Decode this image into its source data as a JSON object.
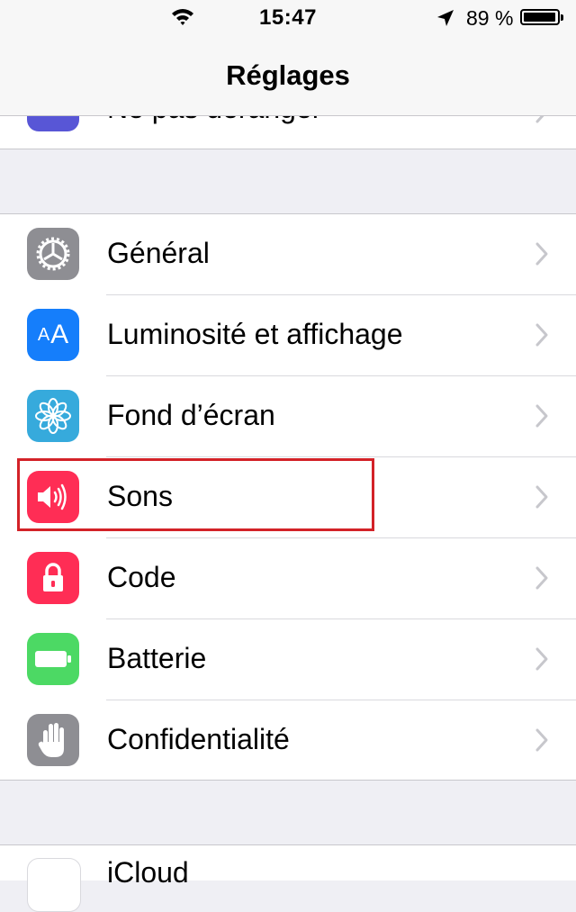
{
  "status_bar": {
    "time": "15:47",
    "battery_percent": "89 %",
    "battery_level": 0.89
  },
  "nav": {
    "title": "Réglages"
  },
  "partial_top_item": {
    "label": "Ne pas déranger",
    "icon_color": "#5856d6",
    "icon": "moon-icon"
  },
  "settings_items": [
    {
      "label": "Général",
      "icon": "gear-icon",
      "icon_color": "#8e8e93"
    },
    {
      "label": "Luminosité et affichage",
      "icon": "text-size-icon",
      "icon_color": "#157efb"
    },
    {
      "label": "Fond d’écran",
      "icon": "flower-icon",
      "icon_color": "#36aadc"
    },
    {
      "label": "Sons",
      "icon": "speaker-icon",
      "icon_color": "#ff2d55"
    },
    {
      "label": "Code",
      "icon": "lock-icon",
      "icon_color": "#ff2d55"
    },
    {
      "label": "Batterie",
      "icon": "battery-icon",
      "icon_color": "#4cd964"
    },
    {
      "label": "Confidentialité",
      "icon": "hand-icon",
      "icon_color": "#8e8e93"
    }
  ],
  "partial_bottom_item": {
    "label": "iCloud",
    "icon": "cloud-icon",
    "icon_color": "#ffffff"
  },
  "highlight": {
    "target": "Sons",
    "color": "#d32228"
  }
}
